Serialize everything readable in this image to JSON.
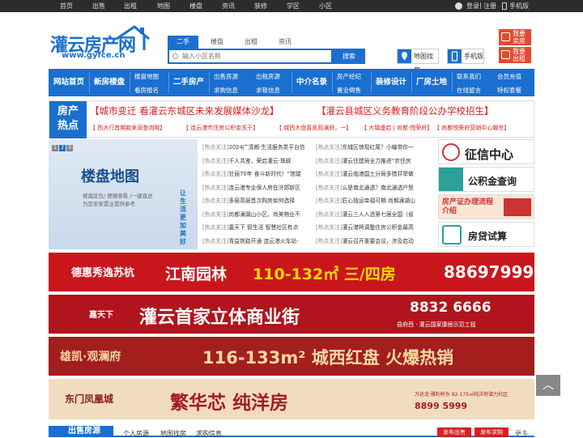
{
  "topbar": {
    "nav": [
      "首页",
      "出售",
      "出租",
      "地图",
      "楼盘",
      "资讯",
      "装修",
      "学区",
      "小区"
    ],
    "login": "登录",
    "sep": "|",
    "register": "注册",
    "mobile": "手机版"
  },
  "logo": {
    "cn": "灌云房产网",
    "en": "www.gyfce.cn"
  },
  "search": {
    "tabs": [
      "二手",
      "楼盘",
      "出租",
      "资讯"
    ],
    "active_tab": "二手",
    "placeholder": "输入小区名称",
    "button": "搜索"
  },
  "header_buttons": {
    "map": "地图找房",
    "mobile": "手机版"
  },
  "red_buttons": [
    {
      "line1": "我要",
      "line2": "卖房"
    },
    {
      "line1": "我要",
      "line2": "出租"
    }
  ],
  "mainnav": {
    "home": "网站首页",
    "new": "新房楼盘",
    "map": "楼盘地图",
    "sign": "看房报名",
    "second": "二手房产",
    "sale": "出售房源",
    "rent_house": "出租房源",
    "consult": "求购信息",
    "rent_seek": "求租信息",
    "agent": "中介名录",
    "prop_mgmt": "房产经纪",
    "industry": "置业倒售",
    "decor": "装修设计",
    "factory": "厂房土地",
    "contact": "联系我们",
    "leave": "在线留言",
    "join": "会员充值",
    "vip": "特权套餐"
  },
  "hot": {
    "tag1": "房产",
    "tag2": "热点",
    "headline1": "【城市变迁 看灌云东城区未来发展媒体沙龙】",
    "headline2": "【灌云县城区义务教育阶段公办学校招生】",
    "news": [
      "【 西大行首期款来源查询哦】",
      "【 连云港市住房公积金关于】",
      "【 城西大盘喜凯观澜府，一】",
      "【 大镇盛启 | 尚都·悦荣府】",
      "【 尚都悦荣府营销中心耀世】"
    ]
  },
  "banner": {
    "title": "楼盘地图",
    "desc1": "楼盘区位/ 便捷查看 /一键直达",
    "desc2": "为您安家置业提供参考",
    "side": "让生活更加美好",
    "pages": [
      "1",
      "2",
      "3"
    ]
  },
  "newslist": [
    {
      "pre": "[热点关注]",
      "text": "2024广清朗·生活服务类平台信"
    },
    {
      "pre": "[热点关注]",
      "text": "东城区惊现红尾？小编带你一"
    },
    {
      "pre": "[热点关注]",
      "text": "千人共鉴，荣启灌云·珠联"
    },
    {
      "pre": "[热点关注]",
      "text": "灌云住建局全力推进“农住房"
    },
    {
      "pre": "[热点关注]",
      "text": "壮丽70年 奋斗新时代！“馆瑞"
    },
    {
      "pre": "[热点关注]",
      "text": "灌云临港国土分局多措并举做"
    },
    {
      "pre": "[热点关注]",
      "text": "连云港专业保人房在浒郊新区"
    },
    {
      "pre": "[热点关注]",
      "text": "么是南北通透？南北通透户型"
    },
    {
      "pre": "[热点关注]",
      "text": "多层高层首次购房如何选择"
    },
    {
      "pre": "[热点关注]",
      "text": "匠心独运幸福可期 尚都澜湖山"
    },
    {
      "pre": "[热点关注]",
      "text": "尚都澜湖山小区。尚美物业不"
    },
    {
      "pre": "[热点关注]",
      "text": "灌云三人入选第七届全国（省"
    },
    {
      "pre": "[热点关注]",
      "text": "嘉天下 智生活 智慧社区有点"
    },
    {
      "pre": "[热点关注]",
      "text": "灌云港将调整住房公积金最高"
    },
    {
      "pre": "[热点关注]",
      "text": "青益铁路开通 连云港火车站-"
    },
    {
      "pre": "[热点关注]",
      "text": "灌云召开重要会议，涉及启动"
    }
  ],
  "side_buttons": [
    "征信中心",
    "公积金查询",
    "房产证办理流程介绍",
    "房贷试算"
  ],
  "ads": [
    {
      "brand": "德惠秀逸苏杭",
      "name": "江南园林",
      "area": "110-132㎡ 三/四房",
      "phone": "88697999"
    },
    {
      "brand": "嘉天下",
      "name": "灌云首家立体商业街",
      "phone": "8832 6666",
      "sub": "县府西 · 灌云国家康居示范工程"
    },
    {
      "brand": "雄凯·观澜府",
      "name": "116-133m² 城西红盘 火爆热销"
    },
    {
      "brand": "东门凤凰城",
      "name": "繁华芯 纯洋房",
      "sub": "万达北·雅利桥东 82-175㎡纯洋房潜力社区",
      "phone": "8899 5999"
    }
  ],
  "bottom": {
    "section": "出售房源",
    "links": [
      "个人房源",
      "地图找房",
      "求购信息"
    ],
    "btn1": "发布出售",
    "btn2": "发布求购",
    "more": "更多"
  },
  "colors": {
    "brand": "#1a6fd1",
    "red": "#d6201f",
    "orange": "#e24b2c"
  }
}
